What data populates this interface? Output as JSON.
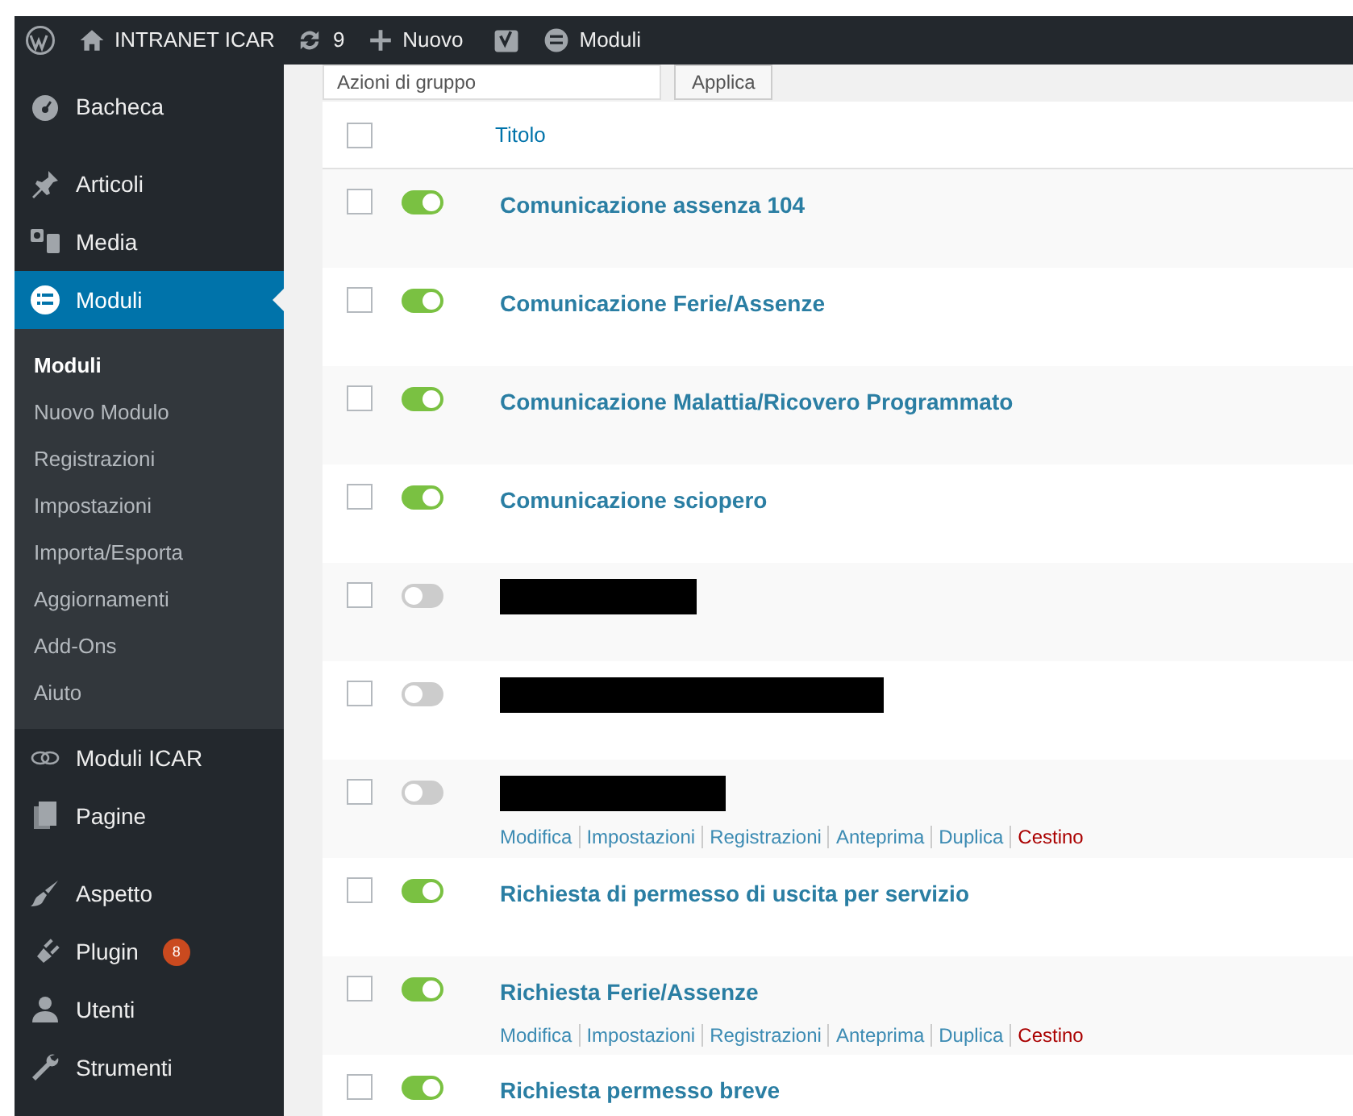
{
  "admin_bar": {
    "site": "INTRANET ICAR",
    "updates": "9",
    "new": "Nuovo",
    "forms": "Moduli"
  },
  "sidebar": {
    "groups": [
      [
        {
          "label": "Bacheca",
          "selected": false
        }
      ],
      [
        {
          "label": "Articoli",
          "selected": false
        },
        {
          "label": "Media",
          "selected": false
        },
        {
          "label": "Moduli",
          "selected": true,
          "submenu": [
            {
              "label": "Moduli",
              "selected": true
            },
            {
              "label": "Nuovo Modulo",
              "selected": false
            },
            {
              "label": "Registrazioni",
              "selected": false
            },
            {
              "label": "Impostazioni",
              "selected": false
            },
            {
              "label": "Importa/Esporta",
              "selected": false
            },
            {
              "label": "Aggiornamenti",
              "selected": false
            },
            {
              "label": "Add-Ons",
              "selected": false
            },
            {
              "label": "Aiuto",
              "selected": false
            }
          ]
        },
        {
          "label": "Moduli ICAR",
          "selected": false
        },
        {
          "label": "Pagine",
          "selected": false
        }
      ],
      [
        {
          "label": "Aspetto",
          "selected": false
        },
        {
          "label": "Plugin",
          "selected": false,
          "badge": "8"
        },
        {
          "label": "Utenti",
          "selected": false
        },
        {
          "label": "Strumenti",
          "selected": false
        }
      ]
    ]
  },
  "toolbar": {
    "bulk_actions": "Azioni di gruppo",
    "apply": "Applica"
  },
  "table": {
    "header": {
      "checked": false,
      "title": "Titolo"
    },
    "rows": [
      {
        "kind": "form",
        "title": "Comunicazione assenza 104",
        "active": true,
        "checked": false
      },
      {
        "kind": "form",
        "title": "Comunicazione Ferie/Assenze",
        "active": true,
        "checked": false
      },
      {
        "kind": "form",
        "title": "Comunicazione Malattia/Ricovero Programmato",
        "active": true,
        "checked": false
      },
      {
        "kind": "form",
        "title": "Comunicazione sciopero",
        "active": true,
        "checked": false
      },
      {
        "kind": "redacted",
        "active": false,
        "checked": false
      },
      {
        "kind": "redacted",
        "active": false,
        "checked": false
      },
      {
        "kind": "redacted",
        "active": false,
        "checked": false,
        "actions": [
          {
            "label": "Modifica",
            "kind": "link"
          },
          {
            "label": "Impostazioni",
            "kind": "link"
          },
          {
            "label": "Registrazioni",
            "kind": "link"
          },
          {
            "label": "Anteprima",
            "kind": "link"
          },
          {
            "label": "Duplica",
            "kind": "link"
          },
          {
            "label": "Cestino",
            "kind": "trash"
          }
        ]
      },
      {
        "kind": "form",
        "title": "Richiesta di permesso di uscita per servizio",
        "active": true,
        "checked": false
      },
      {
        "kind": "form",
        "title": "Richiesta Ferie/Assenze",
        "active": true,
        "checked": false,
        "actions": [
          {
            "label": "Modifica",
            "kind": "link"
          },
          {
            "label": "Impostazioni",
            "kind": "link"
          },
          {
            "label": "Registrazioni",
            "kind": "link"
          },
          {
            "label": "Anteprima",
            "kind": "link"
          },
          {
            "label": "Duplica",
            "kind": "link"
          },
          {
            "label": "Cestino",
            "kind": "trash"
          }
        ]
      },
      {
        "kind": "form",
        "title": "Richiesta permesso breve",
        "active": true,
        "checked": false
      }
    ]
  }
}
